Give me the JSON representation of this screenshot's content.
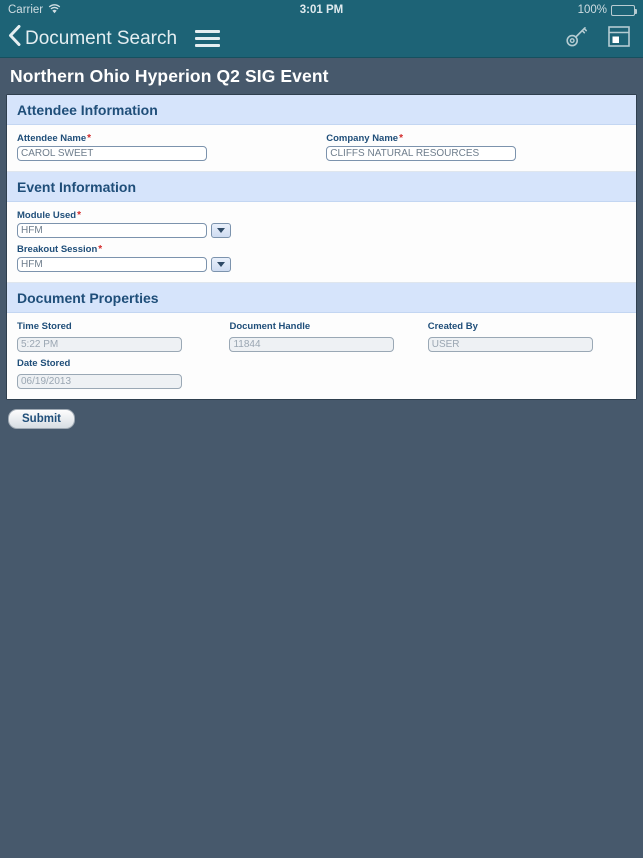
{
  "status_bar": {
    "carrier": "Carrier",
    "wifi_icon": "wifi-icon",
    "time": "3:01 PM",
    "battery_percent": "100%",
    "battery_icon": "battery-icon"
  },
  "nav_bar": {
    "back_label": "Document Search",
    "back_icon": "chevron-left-icon",
    "menu_icon": "hamburger-menu-icon",
    "key_icon": "key-icon",
    "window_icon": "window-layout-icon"
  },
  "page": {
    "title": "Northern Ohio Hyperion Q2 SIG Event"
  },
  "sections": {
    "attendee": {
      "header": "Attendee Information",
      "fields": {
        "attendee_name": {
          "label": "Attendee Name",
          "required": "*",
          "value": "CAROL SWEET"
        },
        "company_name": {
          "label": "Company Name",
          "required": "*",
          "value": "CLIFFS NATURAL RESOURCES"
        }
      }
    },
    "event": {
      "header": "Event Information",
      "fields": {
        "module_used": {
          "label": "Module Used",
          "required": "*",
          "value": "HFM"
        },
        "breakout_session": {
          "label": "Breakout Session",
          "required": "*",
          "value": "HFM"
        }
      }
    },
    "document_properties": {
      "header": "Document Properties",
      "fields": {
        "time_stored": {
          "label": "Time Stored",
          "value": "5:22 PM"
        },
        "document_handle": {
          "label": "Document Handle",
          "value": "11844"
        },
        "created_by": {
          "label": "Created By",
          "value": "USER"
        },
        "date_stored": {
          "label": "Date Stored",
          "value": "06/19/2013"
        }
      }
    }
  },
  "actions": {
    "submit_label": "Submit"
  },
  "colors": {
    "nav_teal": "#1d6376",
    "page_slate": "#47596c",
    "section_blue": "#d6e4fb",
    "label_navy": "#1f4e79",
    "required_red": "#d32b2b"
  }
}
